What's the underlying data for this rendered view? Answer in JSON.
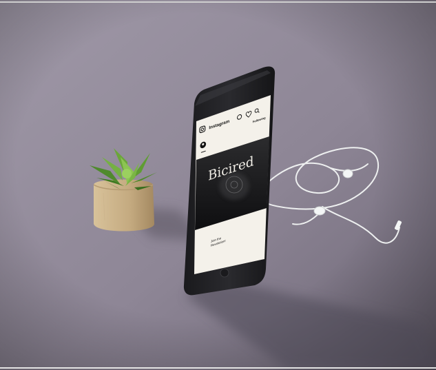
{
  "photo": {
    "subject": "phone-mockup-with-succulent-and-earphones",
    "background_color": "#8d8594",
    "shadow_color": "#5b5563"
  },
  "phone_screen": {
    "app_title": "Instagram",
    "header_action": "Following",
    "hero_title": "Bicired",
    "caption_line1": "Join the",
    "caption_line2": "Revolution!",
    "icons": [
      "instagram-logo-icon",
      "compass-icon",
      "heart-icon",
      "search-icon",
      "profile-icon",
      "menu-icon"
    ]
  },
  "objects": {
    "plant": "succulent-in-wood-pot",
    "earphones": "white-wired-earphones"
  }
}
